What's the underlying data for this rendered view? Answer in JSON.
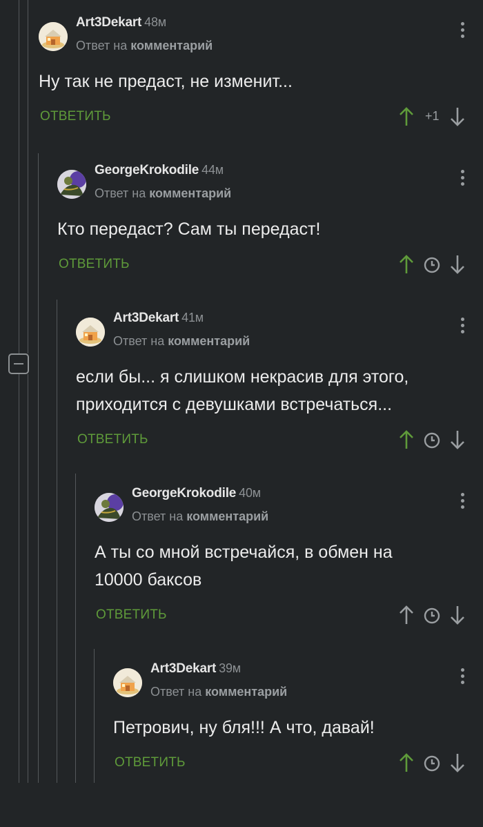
{
  "comments": [
    {
      "author": "Art3Dekart",
      "time": "48м",
      "reply_prefix": "Ответ на",
      "reply_link": "комментарий",
      "text": "Ну так не предаст, не изменит...",
      "reply_label": "ОТВЕТИТЬ",
      "rating": "+1",
      "avatar": "cottage-avatar"
    },
    {
      "author": "GeorgeKrokodile",
      "time": "44м",
      "reply_prefix": "Ответ на",
      "reply_link": "комментарий",
      "text": "Кто передаст? Сам ты передаст!",
      "reply_label": "ОТВЕТИТЬ",
      "avatar": "crocodile-avatar"
    },
    {
      "author": "Art3Dekart",
      "time": "41м",
      "reply_prefix": "Ответ на",
      "reply_link": "комментарий",
      "text": "если бы... я слишком некрасив для этого, приходится с девушками встречаться...",
      "reply_label": "ОТВЕТИТЬ",
      "avatar": "cottage-avatar"
    },
    {
      "author": "GeorgeKrokodile",
      "time": "40м",
      "reply_prefix": "Ответ на",
      "reply_link": "комментарий",
      "text": "А ты со мной встречайся, в обмен на 10000 баксов",
      "reply_label": "ОТВЕТИТЬ",
      "avatar": "crocodile-avatar"
    },
    {
      "author": "Art3Dekart",
      "time": "39м",
      "reply_prefix": "Ответ на",
      "reply_link": "комментарий",
      "text": "Петрович, ну бля!!! А что, давай!",
      "reply_label": "ОТВЕТИТЬ",
      "avatar": "cottage-avatar"
    }
  ],
  "colors": {
    "background": "#222527",
    "accent_green": "#5f9b3a",
    "muted": "#8c9093",
    "upvoted": "#5f9b3a",
    "neutral_arrow": "#9a9ea1"
  },
  "icons": [
    "arrow-up-icon",
    "arrow-down-icon",
    "clock-icon",
    "more-vertical-icon",
    "collapse-icon"
  ]
}
